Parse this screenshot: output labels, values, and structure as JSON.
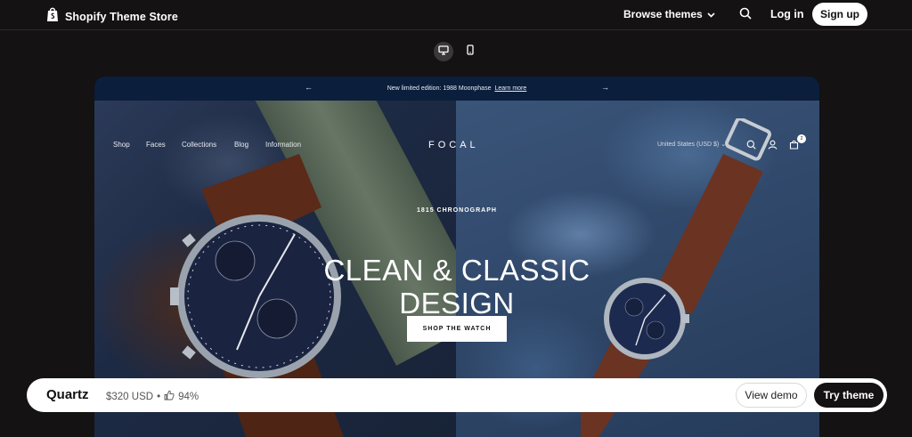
{
  "topnav": {
    "brand_title": "Shopify Theme Store",
    "browse_label": "Browse themes",
    "login_label": "Log in",
    "signup_label": "Sign up"
  },
  "preview": {
    "announcement": {
      "text": "New limited edition: 1988 Moonphase",
      "link": "Learn more",
      "prev": "←",
      "next": "→"
    },
    "store_nav": [
      "Shop",
      "Faces",
      "Collections",
      "Blog",
      "Information"
    ],
    "store_logo": "FOCAL",
    "currency": "United States (USD $) ⌄",
    "cart_count": "2",
    "hero": {
      "subtitle": "1815 CHRONOGRAPH",
      "title_line1": "CLEAN & CLASSIC",
      "title_line2": "DESIGN",
      "cta": "SHOP THE WATCH"
    }
  },
  "bottombar": {
    "theme_name": "Quartz",
    "price": "$320 USD",
    "separator": "•",
    "rating": "94%",
    "view_demo": "View demo",
    "try_theme": "Try theme"
  },
  "colors": {
    "page_bg": "#141213",
    "announcement_bg": "#0b1e3b",
    "button_dark": "#141213",
    "button_light": "#ffffff"
  }
}
